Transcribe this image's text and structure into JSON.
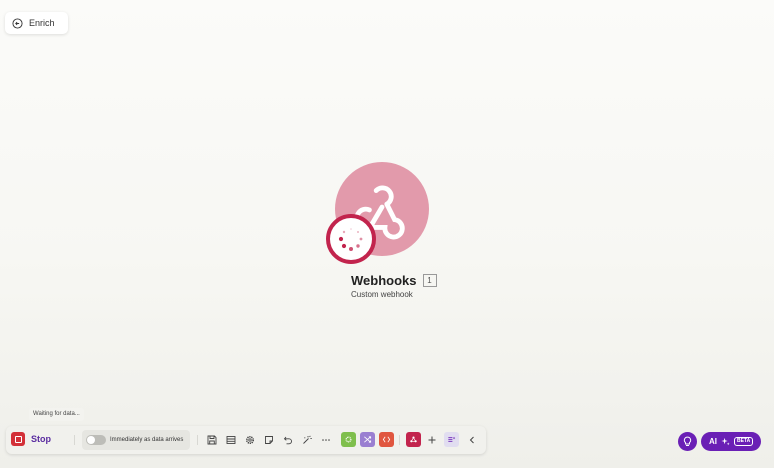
{
  "header": {
    "back_label": "Enrich"
  },
  "module": {
    "title": "Webhooks",
    "count": "1",
    "subtitle": "Custom webhook"
  },
  "status": {
    "text": "Waiting for data..."
  },
  "toolbar": {
    "stop_label": "Stop",
    "schedule_label": "Immediately as data arrives",
    "schedule_enabled": false
  },
  "ai": {
    "label": "AI",
    "badge": "BETA"
  },
  "colors": {
    "accent": "#6a1fb5",
    "webhook_pink": "#e29aab",
    "webhook_crimson": "#c2244d",
    "stop_red": "#d33038",
    "tools_green": "#7fbf4d",
    "flow_purple": "#9a7fd1",
    "text_parser_red": "#e0563f",
    "hub_red": "#c2244d"
  }
}
